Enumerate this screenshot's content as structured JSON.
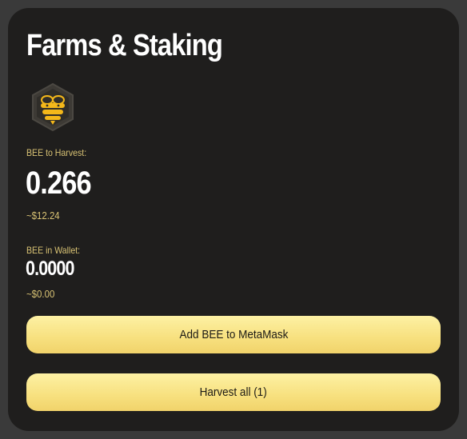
{
  "card": {
    "title": "Farms & Staking",
    "logo_icon": "bee-hexagon-icon",
    "harvest_label": "BEE to Harvest:",
    "harvest_value": "0.266",
    "harvest_usd": "~$12.24",
    "wallet_label": "BEE in Wallet:",
    "wallet_value": "0.0000",
    "wallet_usd": "~$0.00",
    "add_button_label": "Add BEE to MetaMask",
    "harvest_button_label": "Harvest all (1)"
  },
  "colors": {
    "background": "#3a3a3a",
    "card": "#1f1e1d",
    "accent_text": "#d9c374",
    "button": "#f7e07e",
    "logo_yellow": "#f4b81a"
  }
}
